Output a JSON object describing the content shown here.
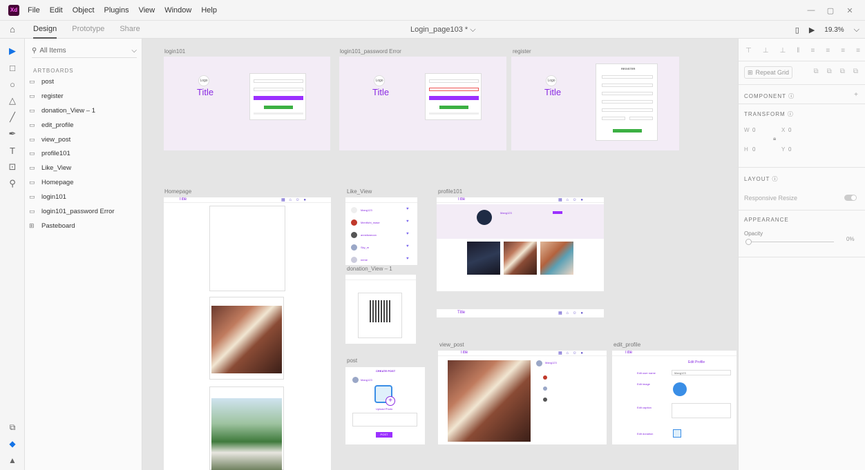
{
  "app": {
    "logo": "Xd"
  },
  "menu": [
    "File",
    "Edit",
    "Object",
    "Plugins",
    "View",
    "Window",
    "Help"
  ],
  "window_controls": {
    "minimize": "—",
    "restore": "▢",
    "close": "✕"
  },
  "tabs": {
    "design": "Design",
    "prototype": "Prototype",
    "share": "Share"
  },
  "document": {
    "title": "Login_page103 * ⌵"
  },
  "zoom": "19.3%",
  "layers": {
    "search": "All Items",
    "section": "ARTBOARDS",
    "items": [
      "post",
      "register",
      "donation_View – 1",
      "edit_profile",
      "view_post",
      "profile101",
      "Like_View",
      "Homepage",
      "login101",
      "login101_password Error",
      "Pasteboard"
    ]
  },
  "artboards": {
    "login101": {
      "label": "login101",
      "logo": "Logo",
      "title": "Title"
    },
    "pwd_error": {
      "label": "login101_password Error",
      "logo": "Logo",
      "title": "Title"
    },
    "register": {
      "label": "register",
      "logo": "Logo",
      "title": "Title",
      "form_title": "REGISTER"
    },
    "homepage": {
      "label": "Homepage",
      "header_title": "Title"
    },
    "like_view": {
      "label": "Like_View",
      "users": [
        "Mang123",
        "Mentfoht_mase",
        "annsfwaroon",
        "Sky_m",
        "neme"
      ]
    },
    "donation": {
      "label": "donation_View – 1"
    },
    "post": {
      "label": "post",
      "create": "CREATE POST",
      "user": "Mang123",
      "upload": "Upload Photo",
      "button": "POST"
    },
    "profile101": {
      "label": "profile101",
      "header_title": "Title",
      "username": "Mang123"
    },
    "strip": {
      "header_title": "Title"
    },
    "view_post": {
      "label": "view_post",
      "header_title": "Title",
      "username": "Mang123"
    },
    "edit_profile": {
      "label": "edit_profile",
      "header_title": "Title",
      "heading": "Edit Profile",
      "fields": [
        "Edit user name",
        "Edit image",
        "Edit caption",
        "Edit donation"
      ],
      "username_value": "Mang123"
    }
  },
  "properties": {
    "repeat_grid": "Repeat Grid",
    "component": "COMPONENT",
    "transform": "TRANSFORM",
    "w_label": "W",
    "w_value": "0",
    "x_label": "X",
    "x_value": "0",
    "h_label": "H",
    "h_value": "0",
    "y_label": "Y",
    "y_value": "0",
    "layout": "LAYOUT",
    "responsive_resize": "Responsive Resize",
    "appearance": "APPEARANCE",
    "opacity_label": "Opacity",
    "opacity_value": "0%"
  },
  "icons": {
    "home": "⌂",
    "select": "▶",
    "rectangle": "□",
    "ellipse": "○",
    "polygon": "△",
    "line": "╱",
    "pen": "✒",
    "text": "T",
    "artboard": "⊡",
    "zoom": "⚲",
    "device": "▯",
    "play": "▶",
    "plugins": "⧉",
    "layers": "◆",
    "assets": "▲"
  }
}
